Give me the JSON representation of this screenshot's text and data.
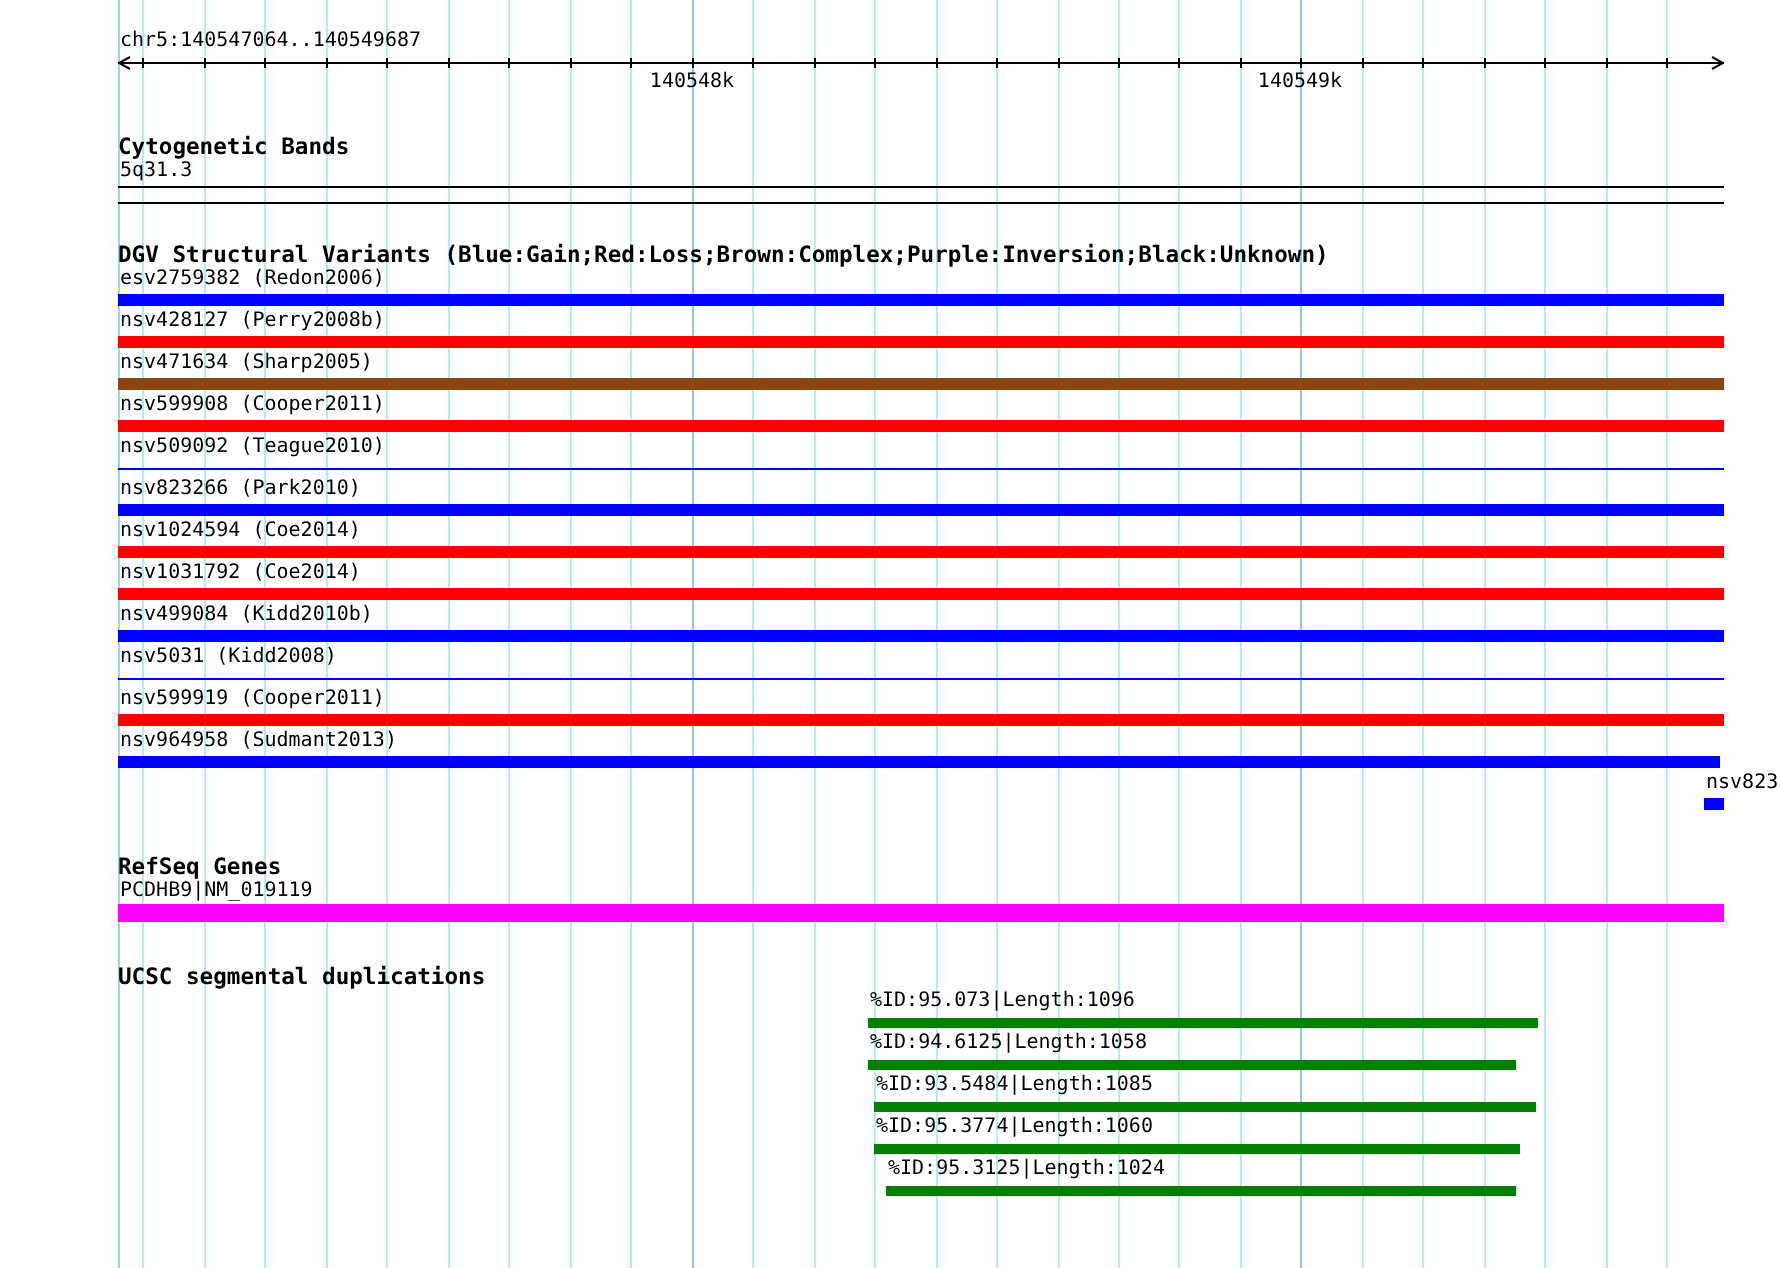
{
  "ruler": {
    "location": "chr5:140547064..140549687",
    "tick_labels": [
      "140548k",
      "140549k"
    ]
  },
  "cytogenetic_bands": {
    "title": "Cytogenetic Bands",
    "features": [
      {
        "label": "5q31.3"
      }
    ]
  },
  "dgv_variants": {
    "title": "DGV Structural Variants (Blue:Gain;Red:Loss;Brown:Complex;Purple:Inversion;Black:Unknown)",
    "features": [
      {
        "label": "esv2759382 (Redon2006)",
        "color": "#0000ff",
        "kind": "bar"
      },
      {
        "label": "nsv428127 (Perry2008b)",
        "color": "#ff0000",
        "kind": "bar"
      },
      {
        "label": "nsv471634 (Sharp2005)",
        "color": "#8b4513",
        "kind": "bar"
      },
      {
        "label": "nsv599908 (Cooper2011)",
        "color": "#ff0000",
        "kind": "bar"
      },
      {
        "label": "nsv509092 (Teague2010)",
        "color": "#0000ff",
        "kind": "line"
      },
      {
        "label": "nsv823266 (Park2010)",
        "color": "#0000ff",
        "kind": "bar"
      },
      {
        "label": "nsv1024594 (Coe2014)",
        "color": "#ff0000",
        "kind": "bar"
      },
      {
        "label": "nsv1031792 (Coe2014)",
        "color": "#ff0000",
        "kind": "bar"
      },
      {
        "label": "nsv499084 (Kidd2010b)",
        "color": "#0000ff",
        "kind": "bar"
      },
      {
        "label": "nsv5031 (Kidd2008)",
        "color": "#0000ff",
        "kind": "line"
      },
      {
        "label": "nsv599919 (Cooper2011)",
        "color": "#ff0000",
        "kind": "bar"
      },
      {
        "label": "nsv964958 (Sudmant2013)",
        "color": "#0000ff",
        "kind": "bar"
      },
      {
        "label": "nsv823",
        "color": "#0000ff",
        "kind": "bar"
      }
    ]
  },
  "refseq_genes": {
    "title": "RefSeq Genes",
    "features": [
      {
        "label": "PCDHB9|NM_019119",
        "color": "#ff00ff"
      }
    ]
  },
  "segmental_duplications": {
    "title": "UCSC segmental duplications",
    "features": [
      {
        "label": "%ID:95.073|Length:1096"
      },
      {
        "label": "%ID:94.6125|Length:1058"
      },
      {
        "label": "%ID:93.5484|Length:1085"
      },
      {
        "label": "%ID:95.3774|Length:1060"
      },
      {
        "label": "%ID:95.3125|Length:1024"
      }
    ]
  }
}
